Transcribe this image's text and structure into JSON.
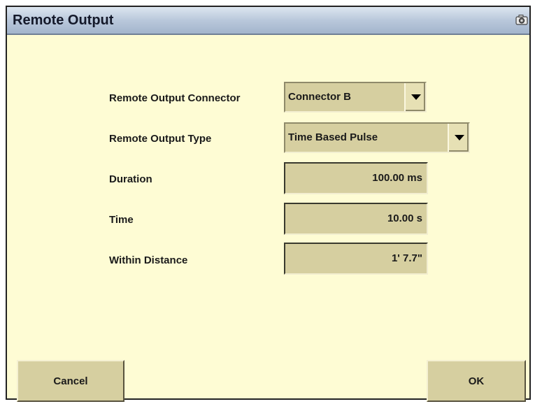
{
  "window": {
    "title": "Remote Output",
    "title_icon": "camera-icon"
  },
  "form": {
    "connector": {
      "label": "Remote Output Connector",
      "value": "Connector B"
    },
    "output_type": {
      "label": "Remote Output Type",
      "value": "Time Based Pulse"
    },
    "duration": {
      "label": "Duration",
      "value": "100.00 ms"
    },
    "time": {
      "label": "Time",
      "value": "10.00 s"
    },
    "within_distance": {
      "label": "Within Distance",
      "value": "1' 7.7\""
    }
  },
  "buttons": {
    "cancel_label": "Cancel",
    "ok_label": "OK"
  },
  "colors": {
    "background": "#fefcd4",
    "control_fill": "#d6cfa0",
    "titlebar": "#b9c8db"
  }
}
